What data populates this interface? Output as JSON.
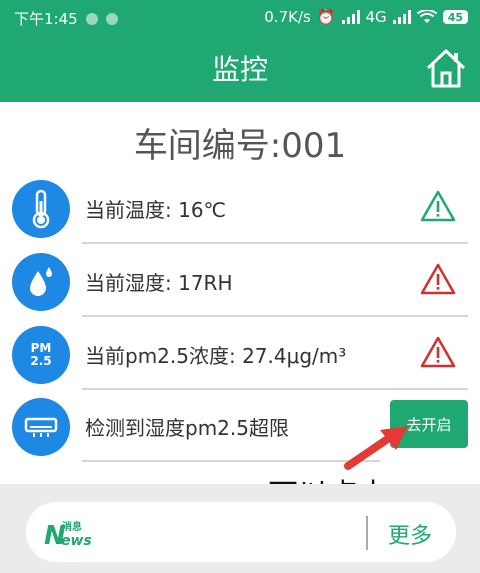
{
  "status_bar": {
    "time": "下午1:45",
    "network_speed": "0.7K/s",
    "network_type": "4G",
    "battery": "45"
  },
  "header": {
    "title": "监控",
    "home_icon": "home-icon"
  },
  "workshop": {
    "label": "车间编号:001"
  },
  "readings": [
    {
      "icon": "thermometer-icon",
      "label": "当前温度: 16℃",
      "warning": "ok",
      "warning_color": "#1fa872"
    },
    {
      "icon": "water-drop-icon",
      "label": "当前湿度: 17RH",
      "warning": "alert",
      "warning_color": "#d32f2f"
    },
    {
      "icon": "pm25-icon",
      "icon_text_top": "PM",
      "icon_text_bottom": "2.5",
      "label": "当前pm2.5浓度: 27.4μg/m³",
      "warning": "alert",
      "warning_color": "#d32f2f"
    }
  ],
  "alert_row": {
    "icon": "air-conditioner-icon",
    "label": "检测到湿度pm2.5超限",
    "button_label": "去开启"
  },
  "annotation": {
    "text": "可以点击",
    "color": "#e53935"
  },
  "news_bar": {
    "logo_top": "消息",
    "logo_main": "News",
    "more_label": "更多"
  },
  "colors": {
    "brand_green": "#1fa872",
    "icon_blue": "#1e88e5"
  }
}
